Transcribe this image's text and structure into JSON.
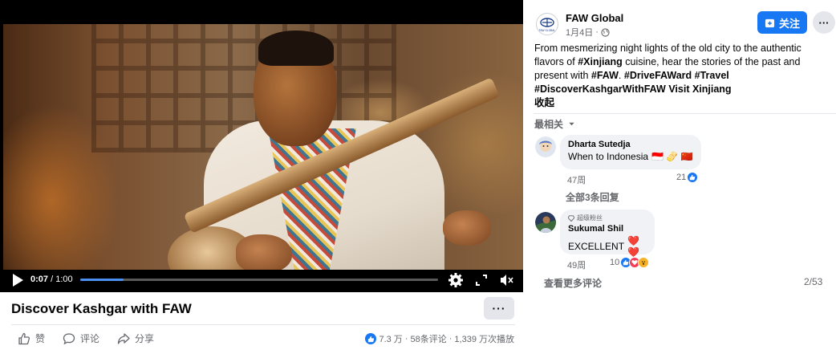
{
  "video": {
    "current_time": "0:07",
    "duration": " / 1:00",
    "progress": 0.12,
    "title": "Discover Kashgar with FAW",
    "more_label": "···"
  },
  "actions": {
    "like": "赞",
    "comment": "评论",
    "share": "分享"
  },
  "stats": {
    "reactions": "7.3 万",
    "separator1": " · ",
    "comments": "58条评论",
    "separator2": " · ",
    "views": "1,339 万次播放"
  },
  "post": {
    "page_name": "FAW Global",
    "logo_text": "FAW GLOBAL",
    "date": "1月4日",
    "dot": "·",
    "follow_label": "关注",
    "more_label": "···",
    "caption": {
      "t1": "From mesmerizing night lights of the old city to the authentic flavors of ",
      "h1": "#Xinjiang",
      "t2": " cuisine, hear the stories of the past and present with ",
      "h2": "#FAW",
      "t3": ". ",
      "h3": "#DriveFAWard",
      "t4": " ",
      "h4": "#Travel",
      "h5": "#DiscoverKashgarWithFAW",
      "t5": " ",
      "h6": "Visit Xinjiang",
      "collapse": "收起"
    },
    "sort_label": "最相关"
  },
  "comments": [
    {
      "name": "Dharta Sutedja",
      "text": "When to Indonesia",
      "emojis": "🇮🇩 🫔 🇨🇳",
      "time": "47周",
      "reactions": "21"
    },
    {
      "badge": "超级粉丝",
      "name": "Sukumal Shil",
      "text": "EXCELLENT",
      "emojis": "❤️❤️",
      "time": "49周",
      "reactions": "10"
    }
  ],
  "replies_link": "全部3条回复",
  "see_more": "查看更多评论",
  "comment_count": "2/53",
  "colors": {
    "brand": "#1877f2",
    "progress": "#4a90f0",
    "secondary_text": "#65676b",
    "bubble": "#f0f2f5"
  }
}
